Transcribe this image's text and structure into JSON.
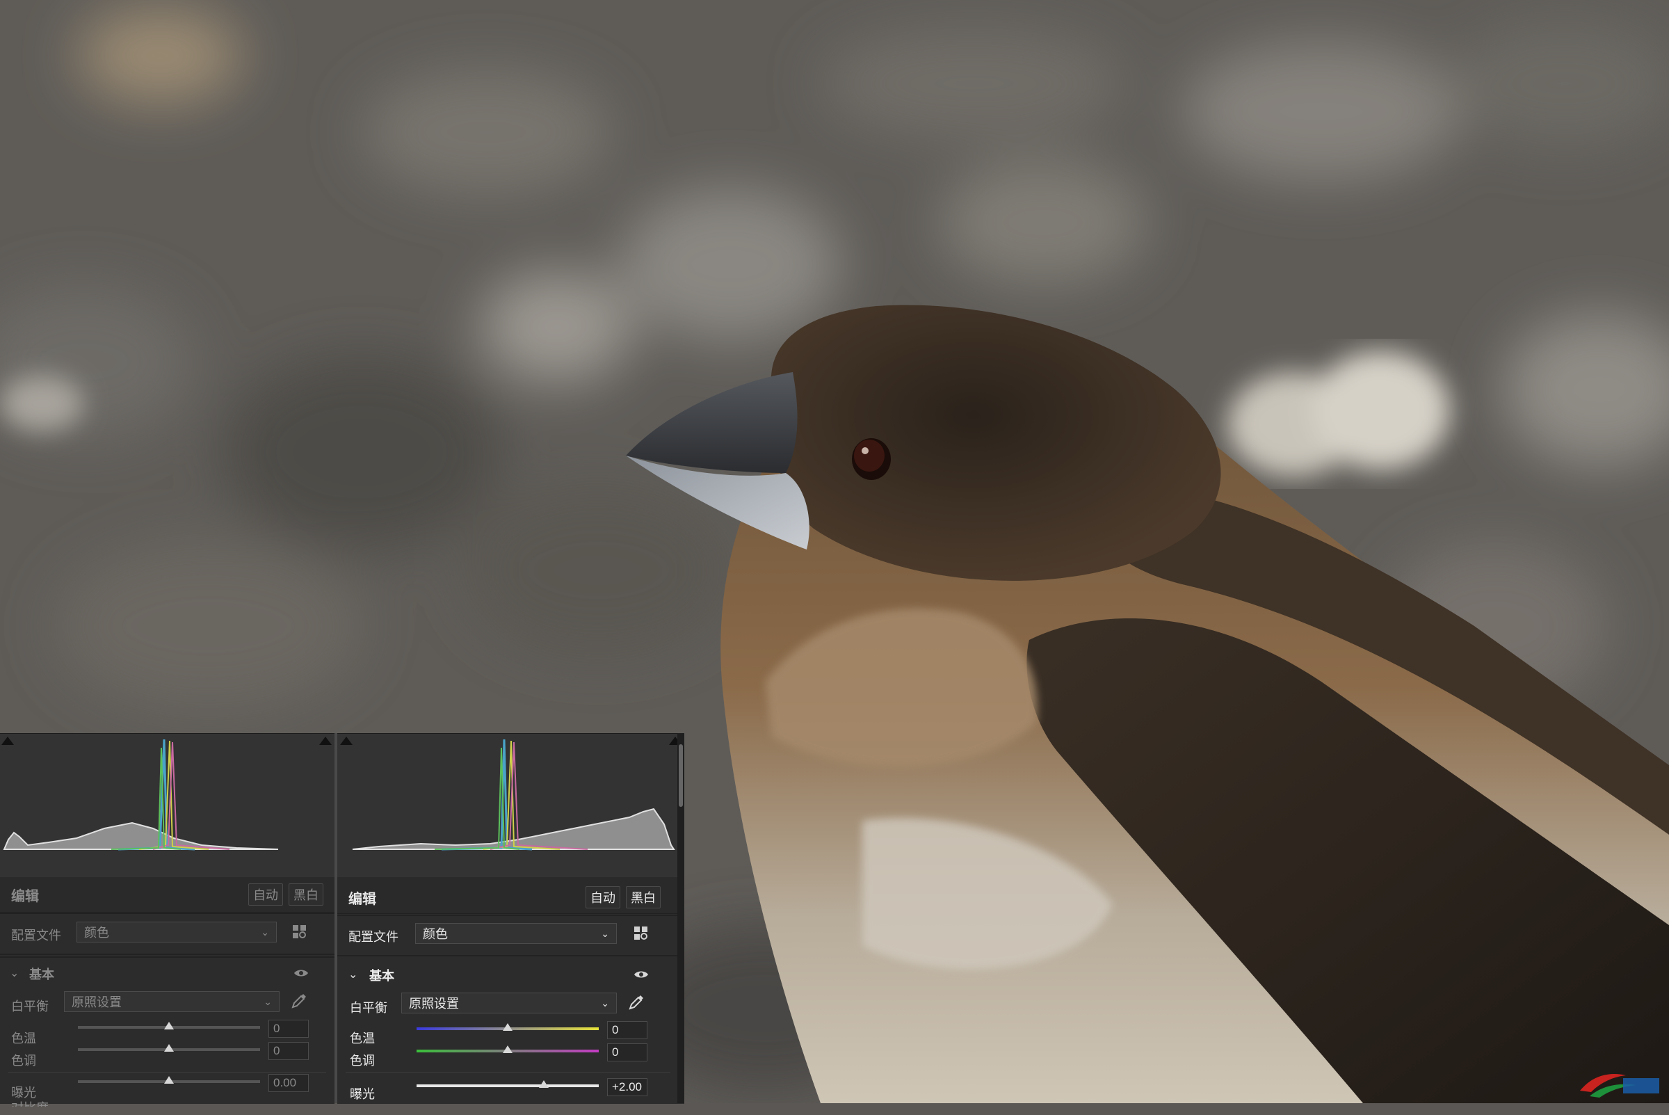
{
  "panels": {
    "left": {
      "header_title": "编辑",
      "auto_label": "自动",
      "bw_label": "黑白",
      "profile_label": "配置文件",
      "profile_value": "颜色",
      "basic_label": "基本",
      "wb_label": "白平衡",
      "wb_value": "原照设置",
      "temp_label": "色温",
      "temp_value": "0",
      "temp_level": 0.5,
      "tint_label": "色调",
      "tint_value": "0",
      "tint_level": 0.5,
      "exposure_label": "曝光",
      "exposure_value": "0.00",
      "exposure_level": 0.5,
      "contrast_label": "对比度"
    },
    "right": {
      "header_title": "编辑",
      "auto_label": "自动",
      "bw_label": "黑白",
      "profile_label": "配置文件",
      "profile_value": "颜色",
      "basic_label": "基本",
      "wb_label": "白平衡",
      "wb_value": "原照设置",
      "temp_label": "色温",
      "temp_value": "0",
      "temp_level": 0.5,
      "tint_label": "色调",
      "tint_value": "0",
      "tint_level": 0.5,
      "exposure_label": "曝光",
      "exposure_value": "+2.00",
      "exposure_level": 0.7
    }
  },
  "icons": {
    "visibility": "eye-icon",
    "eyedropper": "eyedropper-icon",
    "profile_browser": "grid-search-icon",
    "collapse": "chevron-down-icon",
    "select_arrow": "chevron-down-icon",
    "clip_warning": "triangle-clip-icon"
  },
  "colors": {
    "panel_bg": "#2c2c2c",
    "temp_gradient_start": "#3a3adf",
    "temp_gradient_end": "#e6e23a",
    "tint_gradient_start": "#3bbf3b",
    "tint_gradient_end": "#c23cc2"
  }
}
